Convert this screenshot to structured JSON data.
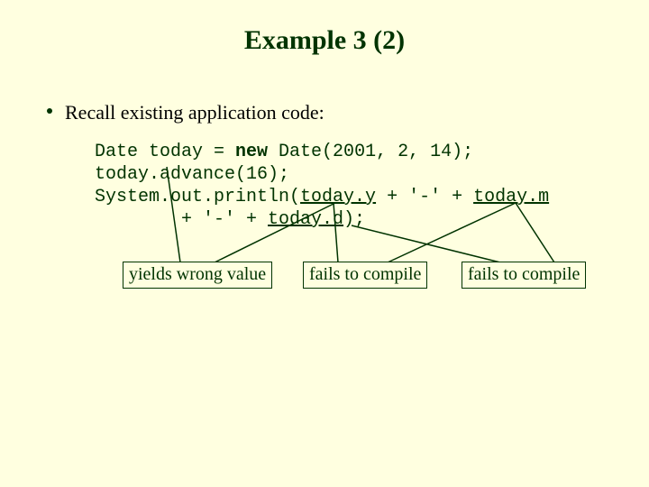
{
  "title": "Example 3 (2)",
  "bullet": "Recall existing application code:",
  "code": {
    "line1_a": "Date today = ",
    "line1_b": "new",
    "line1_c": " Date(2001, 2, 14);",
    "line2": "today.advance(16);",
    "line3_a": "System.out.println(",
    "line3_b": "today.y",
    "line3_c": " + '-' + ",
    "line3_d": "today.m",
    "line4_a": "        + '-' + ",
    "line4_b": "today.d",
    "line4_c": ");"
  },
  "callouts": {
    "c1": "yields wrong value",
    "c2": "fails to compile",
    "c3": "fails to compile"
  }
}
